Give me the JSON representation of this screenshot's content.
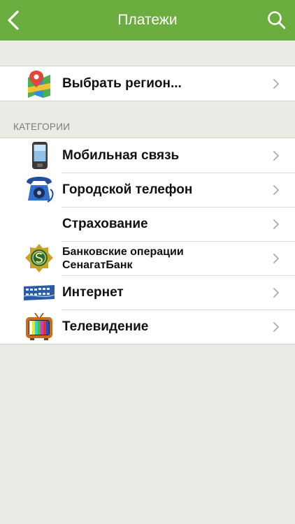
{
  "header": {
    "title": "Платежи"
  },
  "region": {
    "label": "Выбрать регион..."
  },
  "categories": {
    "section_title": "КАТЕГОРИИ",
    "items": [
      {
        "label": "Мобильная связь",
        "icon": "mobile-phone-icon"
      },
      {
        "label": "Городской телефон",
        "icon": "landline-phone-icon"
      },
      {
        "label": "Страхование",
        "icon": ""
      },
      {
        "label_line1": "Банковские операции",
        "label_line2": "СенагатБанк",
        "icon": "bank-emblem-icon"
      },
      {
        "label": "Интернет",
        "icon": "network-switch-icon"
      },
      {
        "label": "Телевидение",
        "icon": "tv-icon"
      }
    ]
  },
  "colors": {
    "navbar": "#6bad3f",
    "background": "#ebebe6",
    "row_background": "#ffffff"
  }
}
